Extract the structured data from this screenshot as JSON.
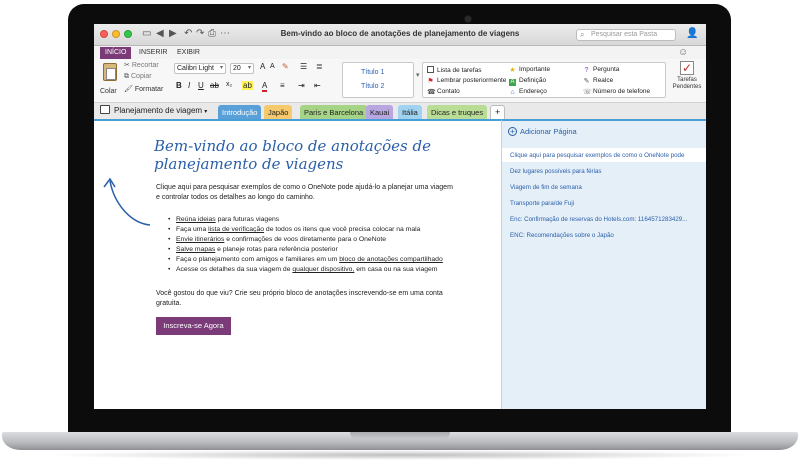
{
  "window": {
    "title": "Bem-vindo ao bloco de anotações de planejamento de viagens",
    "search_placeholder": "Pesquisar esta Pasta"
  },
  "ribbon_tabs": [
    {
      "label": "INÍCIO",
      "active": true
    },
    {
      "label": "INSERIR",
      "active": false
    },
    {
      "label": "EXIBIR",
      "active": false
    }
  ],
  "clipboard": {
    "paste": "Colar",
    "cut": "Recortar",
    "copy": "Copiar",
    "format": "Formatar"
  },
  "font": {
    "family": "Calibri Light",
    "size": "20",
    "bold": "B",
    "italic": "I",
    "underline": "U"
  },
  "styles": [
    "Título 1",
    "Título 2"
  ],
  "tags": [
    {
      "label": "Lista de tarefas",
      "icon": "checkbox-icon"
    },
    {
      "label": "Lembrar posteriormente",
      "icon": "flag-icon"
    },
    {
      "label": "Contato",
      "icon": "phone-icon"
    },
    {
      "label": "Importante",
      "icon": "star-icon"
    },
    {
      "label": "Definição",
      "icon": "definition-icon"
    },
    {
      "label": "Endereço",
      "icon": "home-icon"
    },
    {
      "label": "Pergunta",
      "icon": "question-icon"
    },
    {
      "label": "Realce",
      "icon": "highlight-icon"
    },
    {
      "label": "Número de telefone",
      "icon": "phone-number-icon"
    }
  ],
  "tasks_button": "Tarefas Pendentes",
  "notebook": {
    "name": "Planejamento de viagem"
  },
  "sections": [
    {
      "label": "Introdução",
      "color": "#5aa0d8",
      "active": true
    },
    {
      "label": "Japão",
      "color": "#f6c96d",
      "active": false
    },
    {
      "label": "Paris e Barcelona",
      "color": "#a6d487",
      "active": false
    },
    {
      "label": "Kauai",
      "color": "#b7a6e0",
      "active": false
    },
    {
      "label": "Itália",
      "color": "#9fd3ef",
      "active": false
    },
    {
      "label": "Dicas e truques",
      "color": "#b9dd95",
      "active": false
    }
  ],
  "add_section": "+",
  "page": {
    "title": "Bem-vindo ao bloco de anotações de planejamento de viagens",
    "intro": "Clique aqui para pesquisar exemplos de como o OneNote pode ajudá-lo a planejar uma viagem e controlar todos os detalhes ao longo do caminho.",
    "bullets": [
      {
        "link": "Reúna ideias",
        "pre": "",
        "post": " para futuras viagens"
      },
      {
        "link": "lista de verificação",
        "pre": "Faça uma ",
        "post": " de todos os itens que você precisa colocar na mala"
      },
      {
        "link": "Envie itinerários",
        "pre": "",
        "post": " e confirmações de voos diretamente para o OneNote"
      },
      {
        "link": "Salve mapas",
        "pre": "",
        "post": " e planeje rotas para referência posterior"
      },
      {
        "link": "bloco de anotações compartilhado",
        "pre": "Faça o planejamento com amigos e familiares em um ",
        "post": ""
      },
      {
        "link": "qualquer dispositivo,",
        "pre": "Acesse os detalhes da sua viagem de ",
        "post": " em casa ou na sua viagem"
      }
    ],
    "closing": "Você gostou do que viu? Crie seu próprio bloco de anotações inscrevendo-se em uma conta gratuita.",
    "cta": "Inscreva-se Agora"
  },
  "page_list": {
    "add_page": "Adicionar Página",
    "items": [
      {
        "label": "Clique aqui para pesquisar exemplos de como o OneNote pode",
        "selected": true
      },
      {
        "label": "Dez lugares possíveis para férias",
        "selected": false
      },
      {
        "label": "Viagem de fim de semana",
        "selected": false
      },
      {
        "label": "Transporte para/de Fuji",
        "selected": false
      },
      {
        "label": "Enc: Confirmação de reservas do Hotels.com: 1164571283429...",
        "selected": false
      },
      {
        "label": "ENC: Recomendações sobre o Japão",
        "selected": false
      }
    ]
  },
  "colors": {
    "accent_purple": "#7a3b78",
    "title_blue": "#2a5fa9",
    "page_list_bg": "#e4eff8"
  }
}
